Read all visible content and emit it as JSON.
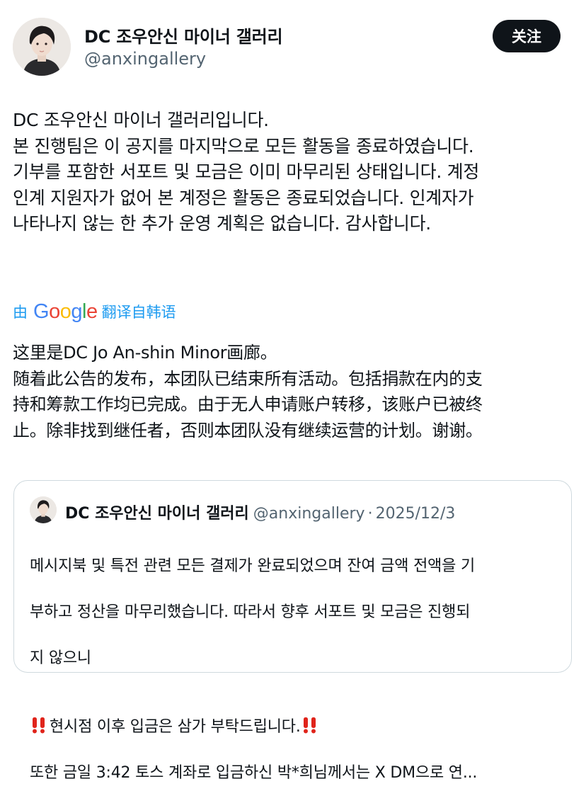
{
  "post": {
    "display_name": "DC 조우안신 마이너 갤러리",
    "handle": "@anxingallery",
    "follow_label": "关注",
    "text": "DC 조우안신 마이너 갤러리입니다.\n본 진행팀은 이 공지를 마지막으로 모든 활동을 종료하였습니다.\n기부를 포함한 서포트 및 모금은 이미 마무리된 상태입니다. 계정\n인계 지원자가 없어 본 계정은 활동은 종료되었습니다. 인계자가\n나타나지 않는 한 추가 운영 계획은 없습니다. 감사합니다."
  },
  "translation": {
    "by_label": "由",
    "provider": "Google",
    "from_label": "翻译自韩语",
    "text": "这里是DC Jo An-shin Minor画廊。\n随着此公告的发布，本团队已结束所有活动。包括捐款在内的支\n持和筹款工作均已完成。由于无人申请账户转移，该账户已被终\n止。除非找到继任者，否则本团队没有继续运营的计划。谢谢。"
  },
  "quoted_post": {
    "display_name": "DC 조우안신 마이너 갤러리",
    "handle": "@anxingallery",
    "separator": "·",
    "date": "2025/12/3",
    "line1": "메시지북 및 특전 관련 모든 결제가 완료되었으며 잔여 금액 전액을 기",
    "line2": "부하고 정산을 마무리했습니다. 따라서 향후 서포트 및 모금은 진행되",
    "line3": "지 않으니",
    "line4": "현시점 이후 입금은 삼가 부탁드립니다.",
    "line5": "또한 금일 3:42 토스 계좌로 입금하신 박*희님께서는 X DM으로 연..."
  },
  "icons": {
    "alert": "double-exclamation-icon",
    "avatar": "avatar"
  },
  "colors": {
    "link": "#1d9bf0",
    "muted": "#536471",
    "button": "#0f1419",
    "alert": "#e0241b",
    "border": "#cfd9de"
  }
}
